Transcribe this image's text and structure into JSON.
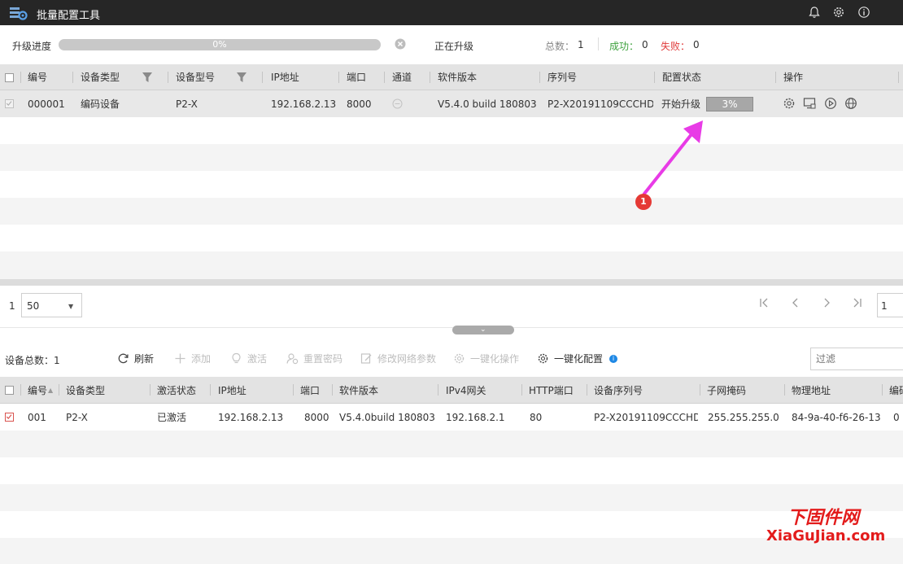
{
  "app": {
    "title": "批量配置工具"
  },
  "upgrade": {
    "label": "升级进度",
    "progress_percent": 0,
    "progress_text": "0%",
    "status": "正在升级",
    "total_label": "总数：",
    "total_value": "1",
    "success_label": "成功：",
    "success_value": "0",
    "fail_label": "失败：",
    "fail_value": "0"
  },
  "upgrade_table": {
    "columns": [
      "编号",
      "设备类型",
      "设备型号",
      "IP地址",
      "端口",
      "通道",
      "软件版本",
      "序列号",
      "配置状态",
      "操作"
    ],
    "rows": [
      {
        "id": "000001",
        "type": "编码设备",
        "model": "P2-X",
        "ip": "192.168.2.13",
        "port": "8000",
        "version": "V5.4.0 build 180803",
        "serial": "P2-X20191109CCCHD...",
        "status": "开始升级",
        "progress_percent": 3,
        "progress_text": "3%"
      }
    ]
  },
  "pager": {
    "current_page": "1",
    "page_size": "50",
    "page_input": "1"
  },
  "toolbar": {
    "total_label": "设备总数：1",
    "refresh": "刷新",
    "add": "添加",
    "activate": "激活",
    "reset_password": "重置密码",
    "modify_network": "修改网络参数",
    "one_click_op": "一键化操作",
    "one_click_config": "一键化配置",
    "filter_placeholder": "过滤"
  },
  "device_table": {
    "columns": [
      "编号",
      "设备类型",
      "激活状态",
      "IP地址",
      "端口",
      "软件版本",
      "IPv4网关",
      "HTTP端口",
      "设备序列号",
      "子网掩码",
      "物理地址",
      "编码"
    ],
    "rows": [
      {
        "id": "001",
        "type": "P2-X",
        "active": "已激活",
        "ip": "192.168.2.13",
        "port": "8000",
        "version": "V5.4.0build 180803",
        "gateway": "192.168.2.1",
        "http_port": "80",
        "serial": "P2-X20191109CCCHD...",
        "mask": "255.255.255.0",
        "mac": "84-9a-40-f6-26-13",
        "extra": "0"
      }
    ]
  },
  "annotation": {
    "badge": "1"
  },
  "watermark": {
    "cn": "下固件网",
    "en": "XiaGuJian.com"
  },
  "colors": {
    "accent": "#5aa0e6",
    "success": "#3fa23f",
    "fail": "#e03b3b",
    "arrow": "#e83be6",
    "badge": "#e53935"
  }
}
